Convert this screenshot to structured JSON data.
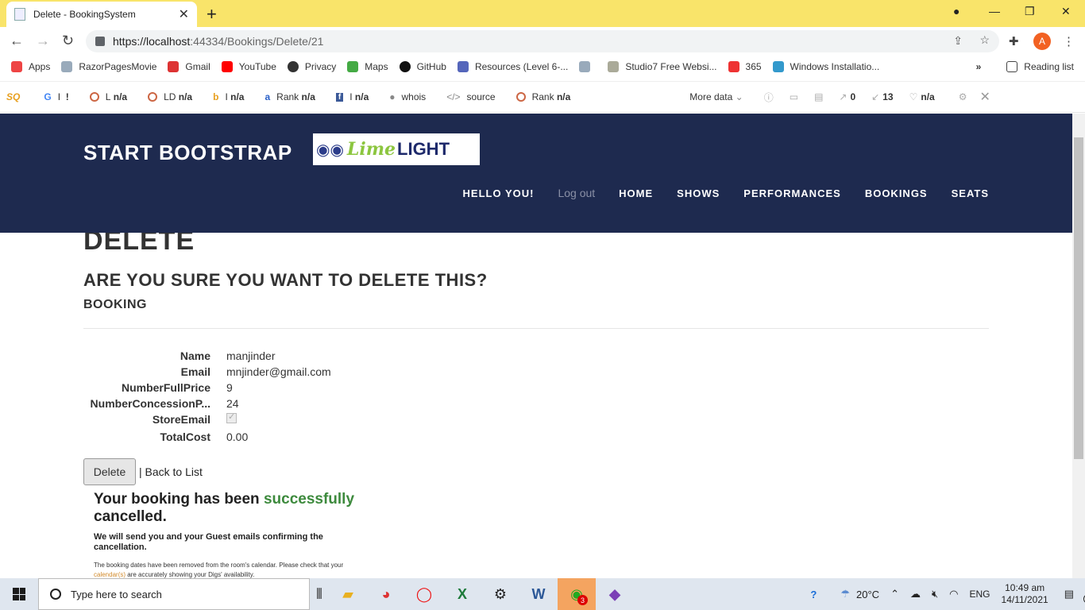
{
  "browser": {
    "tab_title": "Delete - BookingSystem",
    "tab_close": "✕",
    "new_tab": "+",
    "url_host": "https://localhost",
    "url_path": ":44334/Bookings/Delete/21",
    "avatar_letter": "A",
    "bookmarks": [
      {
        "label": "Apps",
        "color": "#e44"
      },
      {
        "label": "RazorPagesMovie",
        "color": "#9ab"
      },
      {
        "label": "Gmail",
        "color": "#d33"
      },
      {
        "label": "YouTube",
        "color": "#f00"
      },
      {
        "label": "Privacy",
        "color": "#333"
      },
      {
        "label": "Maps",
        "color": "#4a4"
      },
      {
        "label": "GitHub",
        "color": "#111"
      },
      {
        "label": "Resources (Level 6-...",
        "color": "#56b"
      },
      {
        "label": "",
        "color": "#9ab"
      },
      {
        "label": "Studio7 Free Websi...",
        "color": "#aa9"
      },
      {
        "label": "365",
        "color": "#e33"
      },
      {
        "label": "Windows Installatio...",
        "color": "#39c"
      }
    ],
    "more_bookmarks": "»",
    "reading_list": "Reading list"
  },
  "seo": {
    "items": [
      {
        "prefix": "I",
        "value": "!"
      },
      {
        "prefix": "L",
        "value": "n/a"
      },
      {
        "prefix": "LD",
        "value": "n/a"
      },
      {
        "prefix": "I",
        "value": "n/a"
      },
      {
        "prefix": "Rank",
        "value": "n/a"
      },
      {
        "prefix": "I",
        "value": "n/a"
      },
      {
        "prefix": "whois",
        "value": ""
      },
      {
        "prefix": "source",
        "value": ""
      },
      {
        "prefix": "Rank",
        "value": "n/a"
      }
    ],
    "more_data": "More data",
    "links_out": "0",
    "links_in": "13",
    "social": "n/a"
  },
  "site": {
    "brand": "START BOOTSTRAP",
    "logo_lime": "Lime",
    "logo_light": "LIGHT",
    "nav": {
      "hello": "HELLO YOU!",
      "logout": "Log out",
      "home": "HOME",
      "shows": "SHOWS",
      "performances": "PERFORMANCES",
      "bookings": "BOOKINGS",
      "seats": "SEATS"
    }
  },
  "page": {
    "title": "DELETE",
    "question": "ARE YOU SURE YOU WANT TO DELETE THIS?",
    "entity": "BOOKING",
    "fields": [
      {
        "label": "Name",
        "value": "manjinder"
      },
      {
        "label": "Email",
        "value": "mnjinder@gmail.com"
      },
      {
        "label": "NumberFullPrice",
        "value": "9"
      },
      {
        "label": "NumberConcessionP...",
        "value": "24"
      },
      {
        "label": "StoreEmail",
        "value": ""
      },
      {
        "label": "TotalCost",
        "value": "0.00"
      }
    ],
    "store_email_checked": true,
    "delete_button": "Delete",
    "back_link": "| Back to List"
  },
  "confirmation": {
    "line1_start": "Your booking has been ",
    "line1_highlight": "successfully",
    "line1_end": "cancelled.",
    "line2": "We will send you and your Guest emails confirming the cancellation.",
    "line3_start": "The booking dates have been removed from the room's calendar. Please check that your ",
    "line3_link": "calendar(s)",
    "line3_end": " are accurately showing your Digs' availability."
  },
  "taskbar": {
    "search_placeholder": "Type here to search",
    "weather": "20°C",
    "lang": "ENG",
    "time": "10:49 am",
    "date": "14/11/2021",
    "notification_count": "1",
    "whatsapp_badge": "3"
  }
}
